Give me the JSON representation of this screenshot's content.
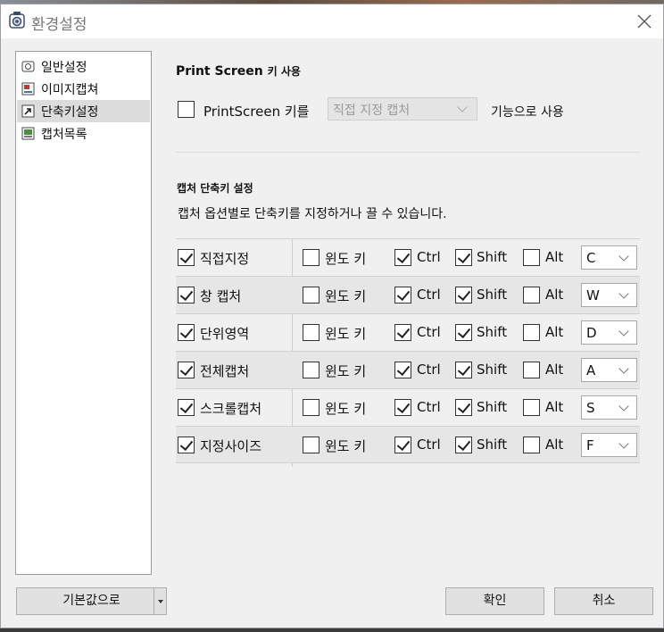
{
  "window": {
    "title": "환경설정"
  },
  "nav": {
    "items": [
      {
        "label": "일반설정",
        "icon": "general-settings-icon",
        "selected": false
      },
      {
        "label": "이미지캡쳐",
        "icon": "image-capture-icon",
        "selected": false
      },
      {
        "label": "단축키설정",
        "icon": "shortcut-icon",
        "selected": true
      },
      {
        "label": "캡처목록",
        "icon": "capture-list-icon",
        "selected": false
      }
    ]
  },
  "printscreen": {
    "title": "Print Screen",
    "title_suffix": "키 사용",
    "checkbox_label": "PrintScreen 키를",
    "checked": false,
    "combo_value": "직접 지정 캡처",
    "suffix_label": "기능으로 사용"
  },
  "shortcuts": {
    "title": "캡처 단축키 설정",
    "description": "캡처 옵션별로 단축키를 지정하거나 끌 수 있습니다.",
    "modifier_labels": {
      "win": "윈도 키",
      "ctrl": "Ctrl",
      "shift": "Shift",
      "alt": "Alt"
    },
    "rows": [
      {
        "name": "직접지정",
        "enabled": true,
        "win": false,
        "ctrl": true,
        "shift": true,
        "alt": false,
        "key": "C"
      },
      {
        "name": "창 캡처",
        "enabled": true,
        "win": false,
        "ctrl": true,
        "shift": true,
        "alt": false,
        "key": "W"
      },
      {
        "name": "단위영역",
        "enabled": true,
        "win": false,
        "ctrl": true,
        "shift": true,
        "alt": false,
        "key": "D"
      },
      {
        "name": "전체캡처",
        "enabled": true,
        "win": false,
        "ctrl": true,
        "shift": true,
        "alt": false,
        "key": "A"
      },
      {
        "name": "스크롤캡처",
        "enabled": true,
        "win": false,
        "ctrl": true,
        "shift": true,
        "alt": false,
        "key": "S"
      },
      {
        "name": "지정사이즈",
        "enabled": true,
        "win": false,
        "ctrl": true,
        "shift": true,
        "alt": false,
        "key": "F"
      }
    ]
  },
  "buttons": {
    "defaults": "기본값으로",
    "ok": "확인",
    "cancel": "취소"
  }
}
